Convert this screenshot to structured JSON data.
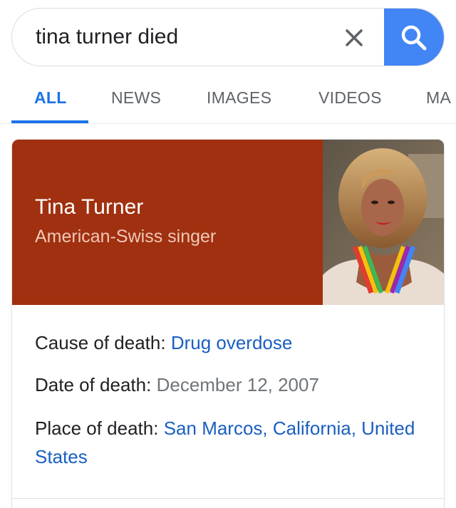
{
  "search": {
    "query": "tina turner died",
    "clear_icon": "close-icon",
    "search_icon": "search-icon",
    "accent": "#4285f4"
  },
  "tabs": [
    {
      "label": "ALL",
      "active": true
    },
    {
      "label": "NEWS",
      "active": false
    },
    {
      "label": "IMAGES",
      "active": false
    },
    {
      "label": "VIDEOS",
      "active": false
    },
    {
      "label": "MA",
      "active": false
    }
  ],
  "knowledge_panel": {
    "name": "Tina Turner",
    "description": "American-Swiss singer",
    "header_color": "#a0300f",
    "facts": {
      "cause_label": "Cause of death:",
      "cause_value": "Drug overdose",
      "date_label": "Date of death:",
      "date_value": "December 12, 2007",
      "place_label": "Place of death:",
      "place_value": "San Marcos, California, United States"
    }
  }
}
